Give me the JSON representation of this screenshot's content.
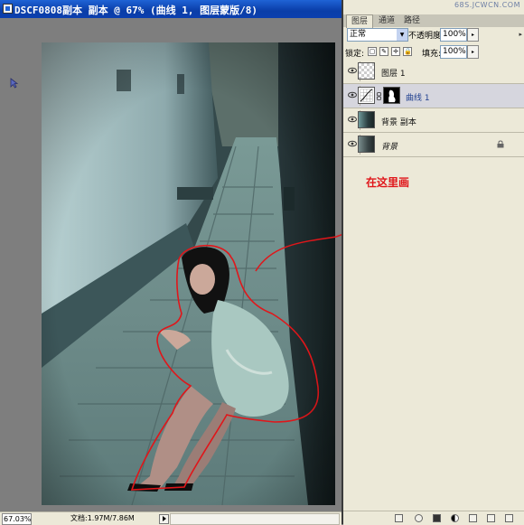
{
  "document": {
    "title": "DSCF0808副本 副本 @ 67% (曲线 1, 图层蒙版/8)",
    "zoom": "67.03%",
    "doc_size": "文档:1.97M/7.86M"
  },
  "panel": {
    "tabs": [
      "图层",
      "通道",
      "路径"
    ],
    "watermark": "68S.JCWCN.COM",
    "menu_label": "▸",
    "blend_mode": "正常",
    "opacity_label": "不透明度:",
    "opacity_value": "100%",
    "lock_label": "锁定:",
    "lock_icons": [
      "▢",
      "✎",
      "✛",
      "🔒"
    ],
    "fill_label": "填充:",
    "fill_value": "100%",
    "stepper": "▸",
    "select_arrow": "▼",
    "layers": [
      {
        "name": "图层 1",
        "selected": false,
        "italic": false
      },
      {
        "name": "曲线 1",
        "selected": true,
        "italic": false
      },
      {
        "name": "背景 副本",
        "selected": false,
        "italic": false
      },
      {
        "name": "背景",
        "selected": false,
        "italic": true
      }
    ]
  },
  "annotation": "在这里画",
  "colors": {
    "titlebar": "#0a3da8",
    "panel_bg": "#ece9d8",
    "annotation_red": "#e0161a",
    "selected_row": "#d6d6de"
  }
}
